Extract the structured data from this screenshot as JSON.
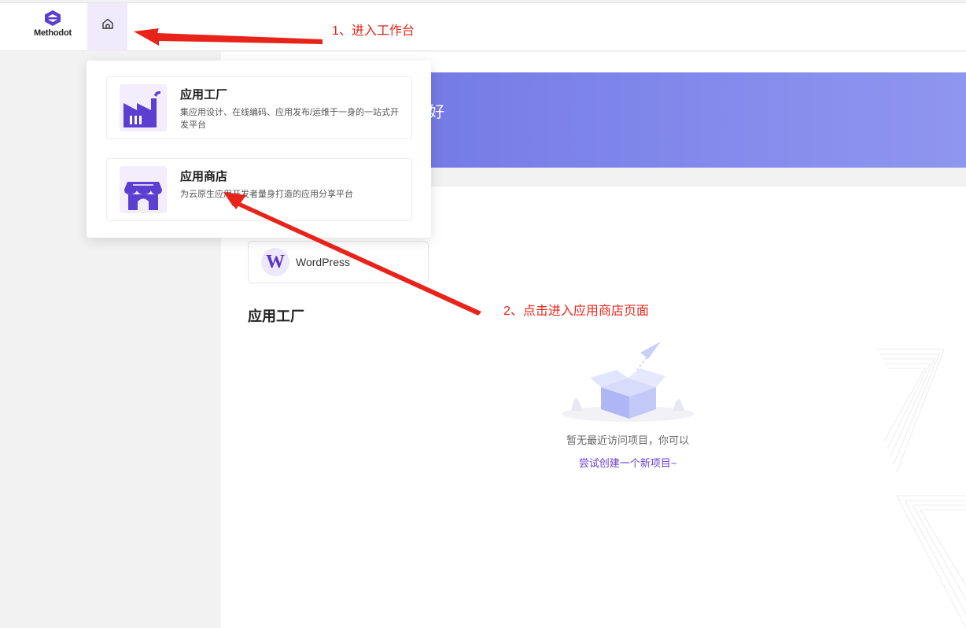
{
  "header": {
    "logo_text": "Methodot"
  },
  "banner": {
    "greeting_partial": "好"
  },
  "dropdown": {
    "items": [
      {
        "title": "应用工厂",
        "description": "集应用设计、在线编码、应用发布/运维于一身的一站式开发平台",
        "icon": "factory-icon"
      },
      {
        "title": "应用商店",
        "description": "为云原生应用开发者量身打造的应用分享平台",
        "icon": "store-icon"
      }
    ]
  },
  "recent_apps": {
    "wordpress_label": "WordPress"
  },
  "factory_section": {
    "title": "应用工厂",
    "empty_text": "暂无最近访问项目，你可以",
    "empty_link": "尝试创建一个新项目~"
  },
  "annotations": {
    "step1": "1、进入工作台",
    "step2": "2、点击进入应用商店页面"
  },
  "colors": {
    "accent": "#6a3fd9",
    "annotation": "#e8241a",
    "banner_start": "#6b6fe0",
    "banner_end": "#8f96ef"
  }
}
